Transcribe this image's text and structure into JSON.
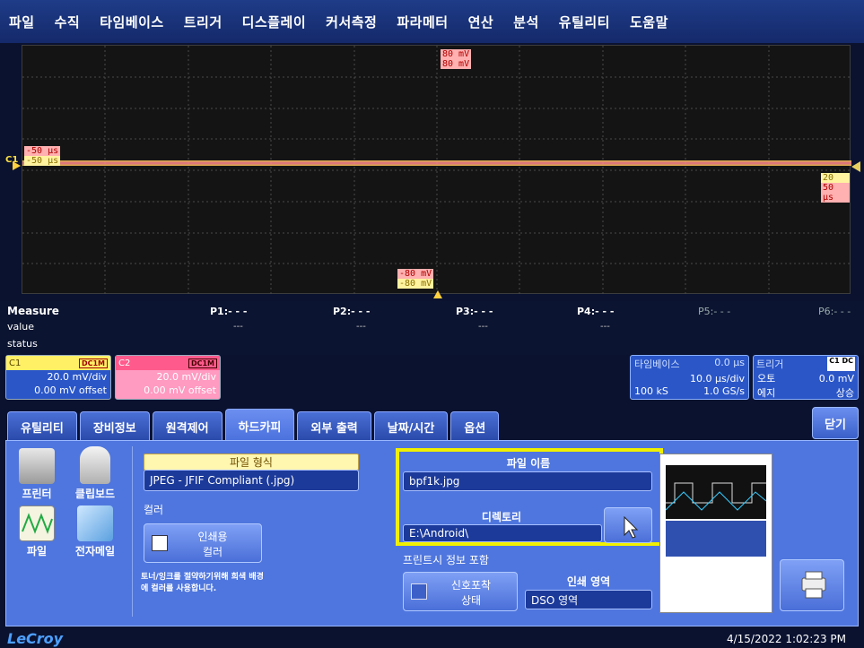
{
  "menu": [
    "파일",
    "수직",
    "타임베이스",
    "트리거",
    "디스플레이",
    "커서측정",
    "파라메터",
    "연산",
    "분석",
    "유틸리티",
    "도움말"
  ],
  "grid_labels": {
    "top_1": "80 mV",
    "top_2": "80 mV",
    "left_1": "-50 µs",
    "left_2": "-50 µs",
    "right_1": "20 µs",
    "right_2": "50 µs",
    "bottom_1": "-80 mV",
    "bottom_2": "-80 mV",
    "c1_marker": "C1"
  },
  "measure": {
    "title": "Measure",
    "row_value": "value",
    "row_status": "status",
    "params": [
      "P1:- - -",
      "P2:- - -",
      "P3:- - -",
      "P4:- - -",
      "P5:- - -",
      "P6:- - -"
    ],
    "dashes": "---"
  },
  "channels": {
    "c1": {
      "name": "C1",
      "coupling": "DC1M",
      "vdiv": "20.0 mV/div",
      "offset": "0.00 mV offset"
    },
    "c2": {
      "name": "C2",
      "coupling": "DC1M",
      "vdiv": "20.0 mV/div",
      "offset": "0.00 mV offset"
    }
  },
  "timebase": {
    "title": "타임베이스",
    "delay": "0.0 µs",
    "tdiv": "10.0 µs/div",
    "samples": "100 kS",
    "rate": "1.0 GS/s"
  },
  "trigger": {
    "title": "트리거",
    "tag": "C1 DC",
    "mode": "오토",
    "level": "0.0 mV",
    "type": "에지",
    "slope": "상승"
  },
  "tabs": [
    "유틸리티",
    "장비정보",
    "원격제어",
    "하드카피",
    "외부 출력",
    "날짜/시간",
    "옵션"
  ],
  "close_label": "닫기",
  "panel": {
    "icons": {
      "printer": "프린터",
      "clipboard": "클립보드",
      "file": "파일",
      "email": "전자메일"
    },
    "format_header": "파일 형식",
    "format_value": "JPEG - JFIF Compliant (.jpg)",
    "color_header": "컬러",
    "color_option_line1": "인쇄용",
    "color_option_line2": "컬러",
    "color_note": "토너/잉크를 절약하기위해 희색 배경에 컬러를 사용합니다.",
    "filename_header": "파일 이름",
    "filename_value": "bpf1k.jpg",
    "directory_header": "디렉토리",
    "directory_value": "E:\\Android\\",
    "include_header": "프린트시 정보 포함",
    "signal_line1": "신호포착",
    "signal_line2": "상태",
    "area_header": "인쇄 영역",
    "area_value": "DSO 영역"
  },
  "footer": {
    "logo": "LeCroy",
    "datetime": "4/15/2022 1:02:23 PM"
  },
  "colors": {
    "highlight": "#f0f000",
    "c1": "#ffe040",
    "c2": "#ff5a8c",
    "panel": "#4f76de"
  }
}
